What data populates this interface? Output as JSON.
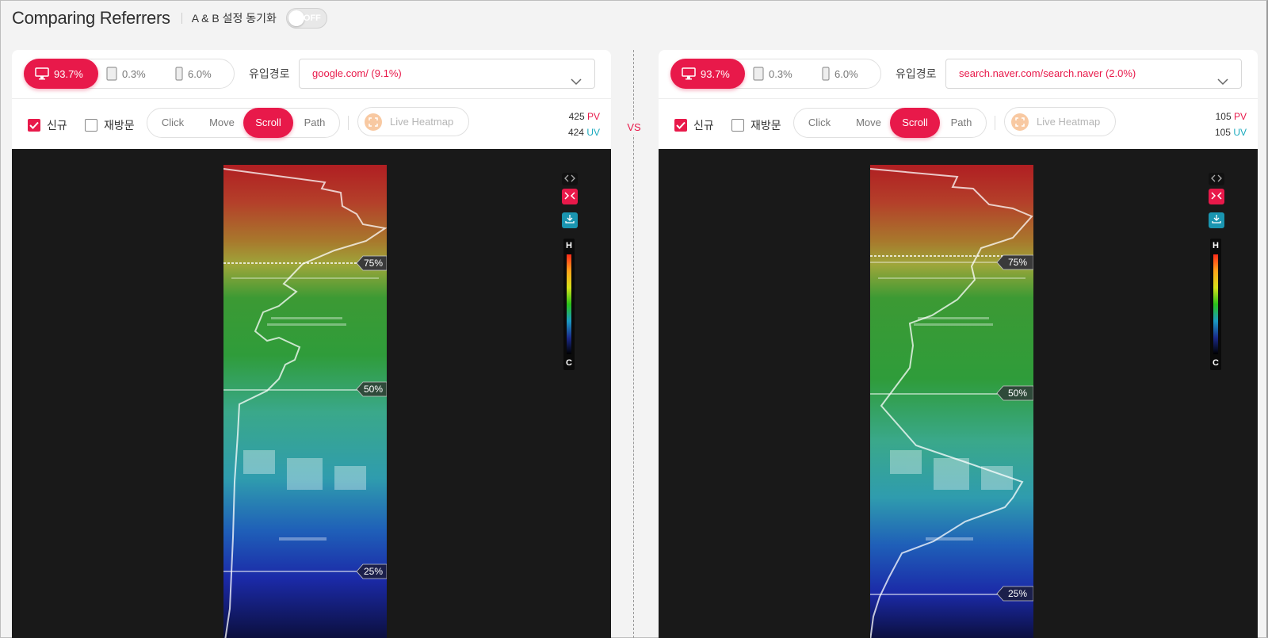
{
  "header": {
    "title": "Comparing Referrers",
    "sync_label": "A & B 설정 동기화",
    "toggle_state": "OFF"
  },
  "vs_label": "VS",
  "panels": [
    {
      "devices": {
        "desktop": "93.7%",
        "tablet": "0.3%",
        "mobile": "6.0%"
      },
      "referrer_label": "유입경로",
      "referrer_value": "google.com/ (9.1%)",
      "checkbox_new": {
        "label": "신규",
        "checked": true
      },
      "checkbox_return": {
        "label": "재방문",
        "checked": false
      },
      "modes": {
        "click": "Click",
        "move": "Move",
        "scroll": "Scroll",
        "path": "Path",
        "active": "Scroll"
      },
      "live_heatmap": "Live Heatmap",
      "pv_count": "425",
      "pv_label": "PV",
      "uv_count": "424",
      "uv_label": "UV",
      "scroll_markers": [
        {
          "label": "75%",
          "value": 75
        },
        {
          "label": "50%",
          "value": 50
        },
        {
          "label": "25%",
          "value": 25
        }
      ],
      "legend": {
        "high": "H",
        "cold": "C"
      }
    },
    {
      "devices": {
        "desktop": "93.7%",
        "tablet": "0.3%",
        "mobile": "6.0%"
      },
      "referrer_label": "유입경로",
      "referrer_value": "search.naver.com/search.naver (2.0%)",
      "checkbox_new": {
        "label": "신규",
        "checked": true
      },
      "checkbox_return": {
        "label": "재방문",
        "checked": false
      },
      "modes": {
        "click": "Click",
        "move": "Move",
        "scroll": "Scroll",
        "path": "Path",
        "active": "Scroll"
      },
      "live_heatmap": "Live Heatmap",
      "pv_count": "105",
      "pv_label": "PV",
      "uv_count": "105",
      "uv_label": "UV",
      "scroll_markers": [
        {
          "label": "75%",
          "value": 75
        },
        {
          "label": "50%",
          "value": 50
        },
        {
          "label": "25%",
          "value": 25
        }
      ],
      "legend": {
        "high": "H",
        "cold": "C"
      }
    }
  ],
  "colors": {
    "accent": "#e8194a",
    "uv": "#1aaabe",
    "viewer_bg": "#191919"
  },
  "icons": [
    "desktop-icon",
    "tablet-icon",
    "mobile-icon",
    "chevron-down-icon",
    "checkbox-icon",
    "live-heatmap-icon",
    "expand-arrows-icon",
    "collapse-icon",
    "download-icon"
  ]
}
